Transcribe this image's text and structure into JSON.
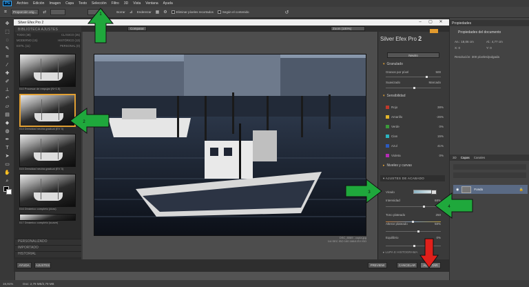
{
  "menubar": {
    "app_icon": "Ps",
    "items": [
      "Archivo",
      "Edición",
      "Imagen",
      "Capa",
      "Texto",
      "Selección",
      "Filtro",
      "3D",
      "Vista",
      "Ventana",
      "Ayuda"
    ]
  },
  "options_bar": {
    "ratio_dropdown": "Proporción orig...",
    "straighten_label": "Enderezar",
    "delete_pixels_label": "Eliminar píxeles recortados",
    "content_aware_label": "Según el contenido"
  },
  "dialog": {
    "title": "Silver Efex Pro 2",
    "compare_label": "Comparar",
    "zoom_label": "Zoom (100%)",
    "library_header": "BIBLIOTECA AJUSTES",
    "preset_tabs": [
      [
        "TODO (38)",
        "CLÁSICO (25)"
      ],
      [
        "MODERNO (15)",
        "HISTÓRICO (13)"
      ],
      [
        "ESTIL (11)",
        "PERSONAL (0)"
      ]
    ],
    "thumbnails": [
      {
        "caption": "010 Procesar de empujar (N+1.5)",
        "selected": false
      },
      {
        "caption": "014 Densidad neutra gradual (EV 3)",
        "selected": true
      },
      {
        "caption": "015 Densidad neutra gradual (EV 3)",
        "selected": false
      },
      {
        "caption": "016 Dinámico completo (duro)",
        "selected": false
      },
      {
        "caption": "017 Dinámico completo (suave)",
        "selected": false
      }
    ],
    "left_sections": [
      "PERSONALIZADO",
      "IMPORTADO",
      "HISTORIAL"
    ],
    "ayuda_label": "AYUDA",
    "ajustes_label": "AJUSTES",
    "photo_caption": "DSC_8069 - copia.jpg",
    "photo_caption2": "1/4 SEC ISO 100 160/4 EV ISO",
    "preview_label": "PREVIEW",
    "cancel_label": "CANCELAR",
    "accept_label": "ACEPTAR"
  },
  "silver_efex": {
    "title_main": "Silver Efex Pro",
    "title_num": "2",
    "preset_dropdown": "Neutro",
    "granulado_label": "Granulado",
    "granos_label": "Granos por píxel",
    "granos_value": "500",
    "suavizado_label": "Suavizado",
    "suavizado_value": "Marcado",
    "sensibilidad_label": "Sensibilidad",
    "colors": [
      {
        "name": "Rojo",
        "value": "38%",
        "swatch": "#c0392b"
      },
      {
        "name": "Amarillo",
        "value": "-26%",
        "swatch": "#e2b52b"
      },
      {
        "name": "Verde",
        "value": "0%",
        "swatch": "#3a9a3a"
      },
      {
        "name": "Cian",
        "value": "15%",
        "swatch": "#2bb5c0"
      },
      {
        "name": "Azul",
        "value": "41%",
        "swatch": "#2b5ac0"
      },
      {
        "name": "Violeta",
        "value": "0%",
        "swatch": "#b52bb5"
      }
    ],
    "niveles_label": "Niveles y curvas",
    "ajustes_acabado_label": "AJUSTES DE ACABADO",
    "viraje_label": "Virado",
    "intensidad_label": "Intensidad",
    "intensidad_value": "68%",
    "tono_label": "Tono plateado",
    "tono_value": "250",
    "alterar_label": "Alterar plateado",
    "alterar_value": "58%",
    "equilibrio_label": "Equilibrio",
    "equilibrio_value": "0%",
    "lupa_label": "LUPA E HISTOGRAMA"
  },
  "right_panel": {
    "properties_tab": "Propiedades",
    "doc_props": "Propiedades del documento",
    "an_label": "An.: 18,06 cm",
    "al_label": "Al.: 4,77 cm",
    "x_label": "X: 0",
    "y_label": "Y: 0",
    "resolution": "Resolución: 300 píxeles/pulgada",
    "layer_tabs": [
      "3D",
      "Capas",
      "Canales"
    ],
    "layer_name": "Fondo"
  },
  "statusbar": {
    "zoom": "16,91%",
    "doc": "Doc: 2,79 MB/2,79 MB"
  },
  "annotations": [
    {
      "label": "1",
      "color": "#1fa83c"
    },
    {
      "label": "2",
      "color": "#1fa83c"
    },
    {
      "label": "3",
      "color": "#1fa83c"
    },
    {
      "label": "4",
      "color": "#1fa83c"
    },
    {
      "label": "",
      "color": "#e0201b"
    }
  ]
}
